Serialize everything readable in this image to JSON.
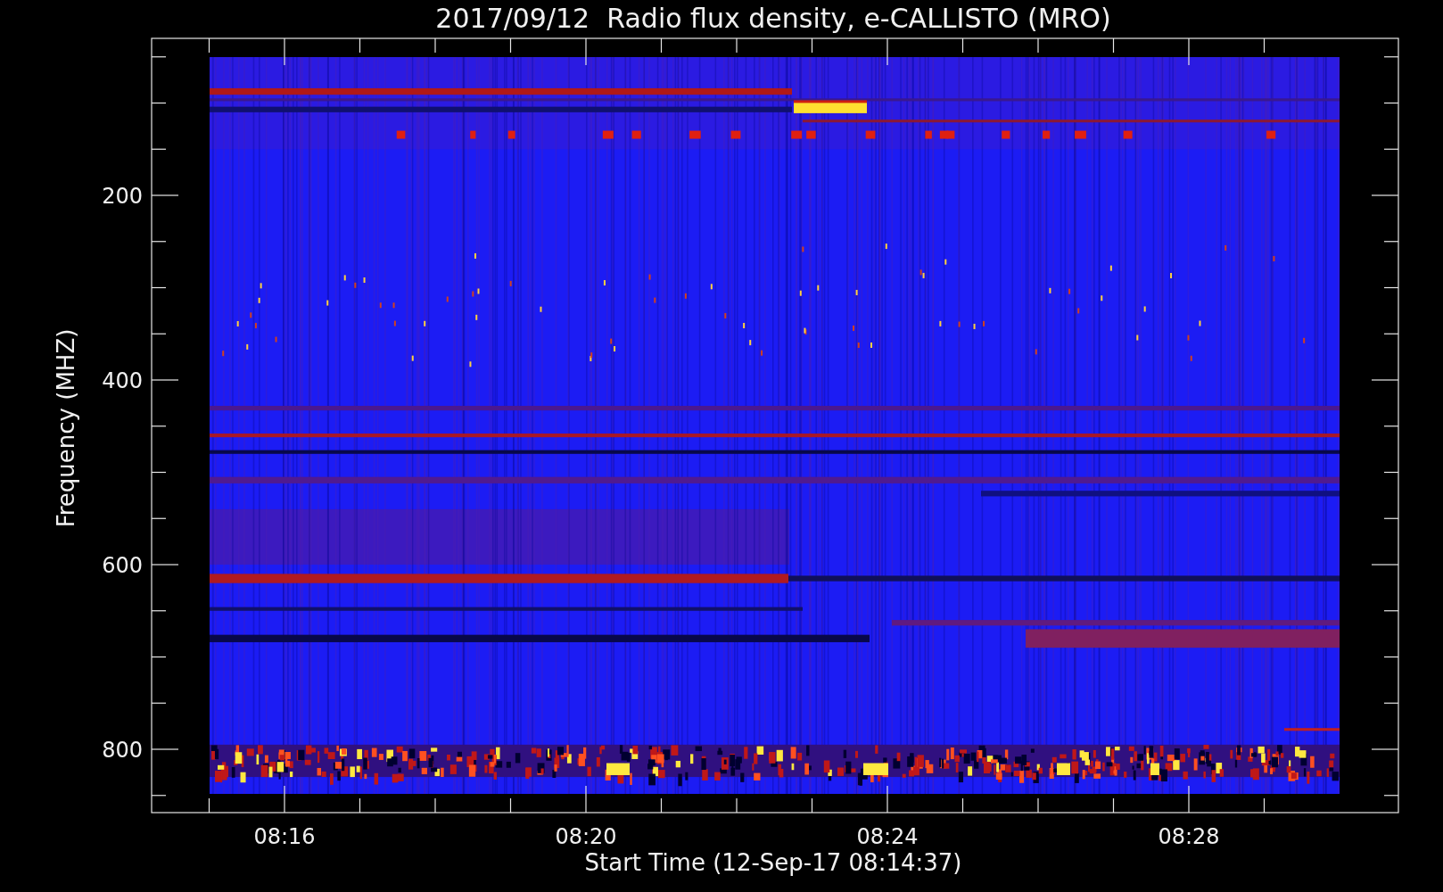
{
  "title": "2017/09/12  Radio flux density, e-CALLISTO (MRO)",
  "ylabel": "Frequency (MHZ)",
  "xlabel": "Start Time (12-Sep-17 08:14:37)",
  "yticks": [
    "200",
    "400",
    "600",
    "800"
  ],
  "xticks": [
    "08:16",
    "08:20",
    "08:24",
    "08:28"
  ]
}
